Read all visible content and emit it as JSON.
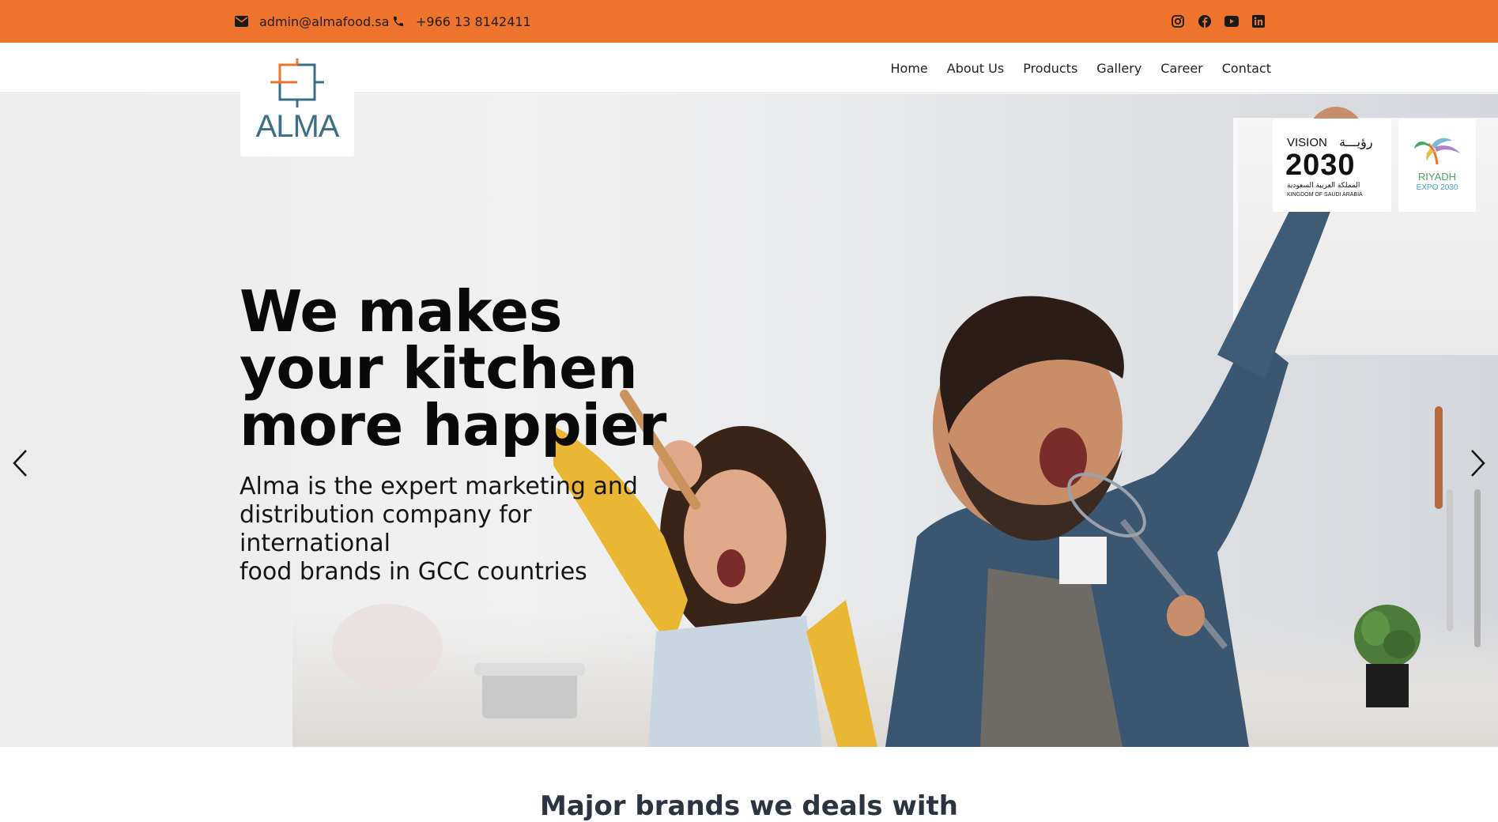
{
  "topbar": {
    "email": "admin@almafood.sa",
    "phone": "+966 13 8142411",
    "accent_color": "#ee742d",
    "social": [
      "instagram-icon",
      "facebook-icon",
      "youtube-icon",
      "linkedin-icon"
    ]
  },
  "logo": {
    "text": "ALMA"
  },
  "nav": {
    "items": [
      "Home",
      "About Us",
      "Products",
      "Gallery",
      "Career",
      "Contact"
    ]
  },
  "hero": {
    "title": "We makes\nyour kitchen\nmore happier",
    "subtitle": "Alma is the expert marketing and\ndistribution company for international\nfood brands in GCC countries"
  },
  "badges": {
    "vision": {
      "word": "VISION",
      "arabic": "رؤيـــة",
      "year": "2030",
      "arabic_country": "المملكة العربية السعودية",
      "country": "KINGDOM OF SAUDI ARABIA"
    },
    "expo": {
      "city": "RIYADH",
      "event": "EXPO 2030"
    }
  },
  "brands_section": {
    "title": "Major brands we deals with"
  }
}
